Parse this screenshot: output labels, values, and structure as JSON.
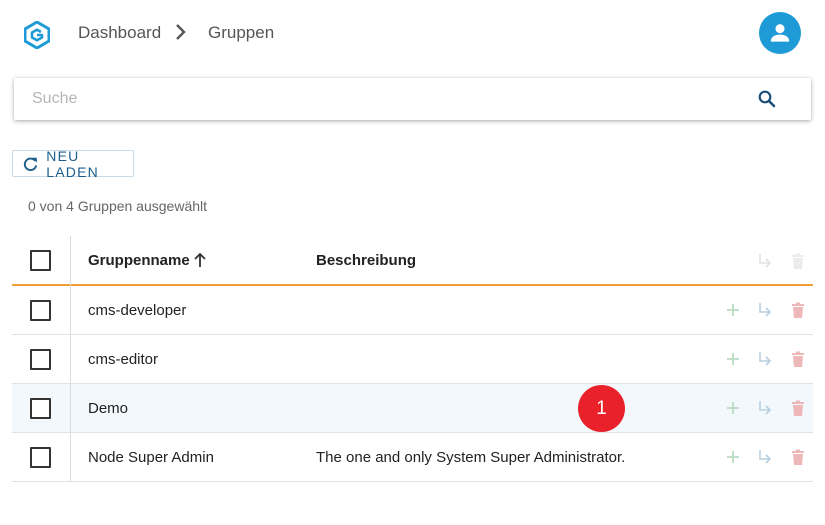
{
  "header": {
    "logo_icon": "logo-icon",
    "breadcrumb": [
      "Dashboard",
      "Gruppen"
    ],
    "avatar_icon": "user-icon",
    "accent": "#1e9bd7"
  },
  "search": {
    "placeholder": "Suche",
    "value": ""
  },
  "toolbar": {
    "reload_label": "NEU LADEN"
  },
  "selection": {
    "text": "0 von 4 Gruppen ausgewählt"
  },
  "table": {
    "columns": {
      "name": "Gruppenname",
      "description": "Beschreibung"
    },
    "sort": "ascending",
    "rows": [
      {
        "name": "cms-developer",
        "description": ""
      },
      {
        "name": "cms-editor",
        "description": ""
      },
      {
        "name": "Demo",
        "description": ""
      },
      {
        "name": "Node Super Admin",
        "description": "The one and only System Super Administrator."
      }
    ],
    "header_border_color": "#f0a033"
  },
  "annotation": {
    "badge_label": "1",
    "badge_color": "#e8212b"
  }
}
